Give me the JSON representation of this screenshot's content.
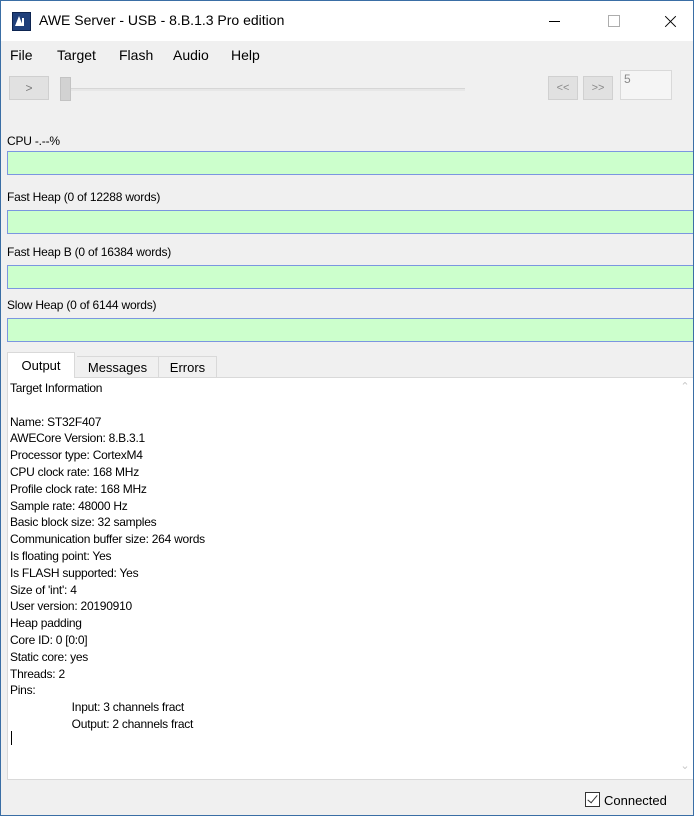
{
  "window": {
    "title": "AWE Server - USB - 8.B.1.3 Pro edition"
  },
  "menu": {
    "items": [
      "File",
      "Target",
      "Flash",
      "Audio",
      "Help"
    ]
  },
  "toolbar": {
    "play_label": ">",
    "prev_label": "<<",
    "next_label": ">>",
    "step_value": "5",
    "slider_position": 0
  },
  "meters": [
    {
      "label": "CPU -.--%",
      "fill_fraction": 0
    },
    {
      "label": "Fast Heap (0 of 12288 words)",
      "fill_fraction": 0
    },
    {
      "label": "Fast Heap B (0 of 16384 words)",
      "fill_fraction": 0
    },
    {
      "label": "Slow Heap (0 of 6144 words)",
      "fill_fraction": 0
    }
  ],
  "tabs": {
    "output": "Output",
    "messages": "Messages",
    "errors": "Errors",
    "active": "Output"
  },
  "output": {
    "text": "Target Information\n\nName: ST32F407\nAWECore Version: 8.B.3.1\nProcessor type: CortexM4\nCPU clock rate: 168 MHz\nProfile clock rate: 168 MHz\nSample rate: 48000 Hz\nBasic block size: 32 samples\nCommunication buffer size: 264 words\nIs floating point: Yes\nIs FLASH supported: Yes\nSize of 'int': 4\nUser version: 20190910\nHeap padding\nCore ID: 0 [0:0]\nStatic core: yes\nThreads: 2\nPins:\n                    Input: 3 channels fract\n                    Output: 2 channels fract"
  },
  "status": {
    "connected_label": "Connected",
    "connected": true
  },
  "colors": {
    "meter_background": "#ccffcc",
    "meter_border": "#7b96e0",
    "window_border": "#3a6ea5"
  }
}
